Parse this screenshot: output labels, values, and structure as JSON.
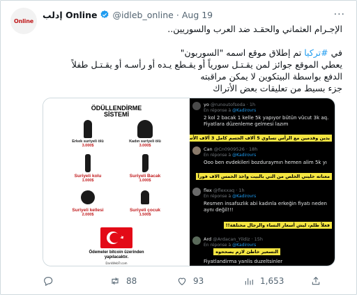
{
  "tweet": {
    "author_name": "إدلب Online",
    "handle": "@idleb_online",
    "dot": "·",
    "date": "Aug 19",
    "avatar_text": "Online",
    "more": "···",
    "line1": "الإجـرام العثماني والحقـد ضد العرب والسوريين..",
    "line2_prefix": "في ",
    "line2_hashtag": "#تركيا",
    "line2_suffix": " تم إطلاق موقع اسمه \"السوربون\"",
    "line3": "يعطي الموقع جوائز لمن يقـتـل سورياً أو يقـطع يـده أو رأسـه أو يقـتـل طفلاً",
    "line4": "الدفع بواسطة البيتكوين لا يمكن مراقبته",
    "line5": "جزء بسيط من تعليقات بعض الأتراك"
  },
  "poster": {
    "title_line1": "ÖDÜLLENDİRME",
    "title_line2": "SİSTEMİ",
    "cells": [
      {
        "label": "Erkek suriyeli ölü",
        "value": "3.000$",
        "red": false
      },
      {
        "label": "Kadın suriyeli ölü",
        "value": "3.000$",
        "red": false
      },
      {
        "label": "Suriyeli kolu",
        "value": "1.000$",
        "red": true
      },
      {
        "label": "Suriyeli Bacak",
        "value": "1.000$",
        "red": true
      },
      {
        "label": "Suriyeli kellesi",
        "value": "2.000$",
        "red": true
      },
      {
        "label": "Suriyeli çocuk",
        "value": "1.500$",
        "red": true
      }
    ],
    "footer_line1": "Ödemeler bitcoin üzerinden",
    "footer_line2": "yapılacaktır.",
    "url": "DarkWebTr.com"
  },
  "replies": [
    {
      "name": "yo",
      "handle": "@runoutofsoda · 1h",
      "reply_prefix": "En réponse à ",
      "mention": "@Kadirovrs",
      "body": "2 kol 2 bacak 1 kelle 5k yapıyor bütün vücut 3k aq. Fiyatlara düzenleme gelmesi lazım",
      "translation": "يدين وقدمين مع الرأس تساوي 5 آلاف الجسم كامل 3 آلاف الأسعار لازم تتعدل"
    },
    {
      "name": "Can",
      "handle": "@Cn0909526 · 18h",
      "reply_prefix": "En réponse à ",
      "mention": "@Kadirovrs",
      "body": "Ooo ben evdekileri bozduraymın hemen alim 5k yı",
      "translation": "معناته خليني الخلص من التي بالبيت واخذ الخمس الاف فوراً"
    },
    {
      "name": "flex",
      "handle": "@flexxaq · 1h",
      "reply_prefix": "En réponse à ",
      "mention": "@Kadirovrs",
      "body": "Resmen insafsızlık abi kadınla erkeğin fiyatı neden aynı değil!!!",
      "translation": "فعلاً ظلم، ليش أسعار النساء والرجال مختلفة!!"
    },
    {
      "name": "Ard",
      "handle": "@Ardacan_Yildiz · 15h",
      "reply_prefix": "En réponse à ",
      "mention": "@Kadirovrs",
      "body": "Fiyatlandirma yanlis duzeltsinler",
      "translation": "التسعير خاطئ لازم يصححوه"
    }
  ],
  "actions": {
    "reply_count": "",
    "retweet_count": "88",
    "like_count": "93",
    "view_count": "1,653"
  },
  "colors": {
    "accent": "#1d9bf0",
    "muted": "#536471",
    "highlight": "#f5e642",
    "flag_red": "#e30a17"
  }
}
